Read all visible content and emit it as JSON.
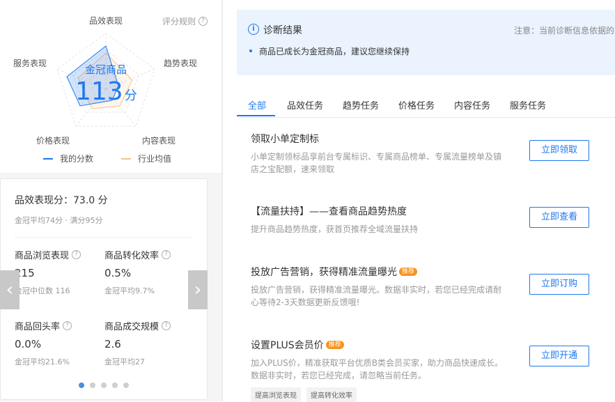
{
  "radar": {
    "axes": {
      "top": "品效表现",
      "right": "趋势表现",
      "left": "服务表现",
      "bottom_left": "价格表现",
      "bottom_right": "内容表现"
    },
    "score_rule": "评分规则",
    "center_title": "金冠商品",
    "center_score": "113",
    "center_unit": "分",
    "legend": {
      "mine": "我的分数",
      "avg": "行业均值"
    },
    "colors": {
      "mine": "#1e78f0",
      "avg": "#f5c28c"
    }
  },
  "metrics": {
    "perf_title": "品效表现分：73.0 分",
    "perf_sub": "金冠平均74分 · 满分95分",
    "items": [
      {
        "label": "商品浏览表现",
        "value": "215",
        "sub": "金冠中位数 116"
      },
      {
        "label": "商品转化效率",
        "value": "0.5%",
        "sub": "金冠平均9.7%"
      },
      {
        "label": "商品回头率",
        "value": "0.0%",
        "sub": "金冠平均21.6%"
      },
      {
        "label": "商品成交规模",
        "value": "2.6",
        "sub": "金冠平均27"
      }
    ],
    "prev_arrow": "‹",
    "next_arrow": "›"
  },
  "diagnosis": {
    "title": "诊断结果",
    "note": "注意：当前诊断信息依据的",
    "item": "商品已成长为金冠商品，建议您继续保持"
  },
  "tabs": [
    "全部",
    "品效任务",
    "趋势任务",
    "价格任务",
    "内容任务",
    "服务任务"
  ],
  "tasks": [
    {
      "title": "领取小单定制标",
      "desc": "小单定制领标品享前台专属标识、专属商品榜单、专属流量榜单及镇店之宝配额，速来领取",
      "button": "立即领取"
    },
    {
      "title": "【流量扶持】——查看商品趋势热度",
      "desc": "提升商品趋势热度，获首页推荐全域流量扶持",
      "button": "立即查看"
    },
    {
      "title": "投放广告营销，获得精准流量曝光",
      "tag": "推荐",
      "desc": "投放广告营销，获得精准流量曝光。数据非实时，若您已经完成请耐心等待2-3天数据更新反馈哦!",
      "button": "立即订购"
    },
    {
      "title": "设置PLUS会员价",
      "tag": "推荐",
      "desc": "加入PLUS价，精准获取平台优质B类会员买家，助力商品快速成长。数据非实时，若您已经完成，请忽略当前任务。",
      "button": "立即开通",
      "chips": [
        "提高浏览表现",
        "提高转化效率"
      ]
    }
  ]
}
